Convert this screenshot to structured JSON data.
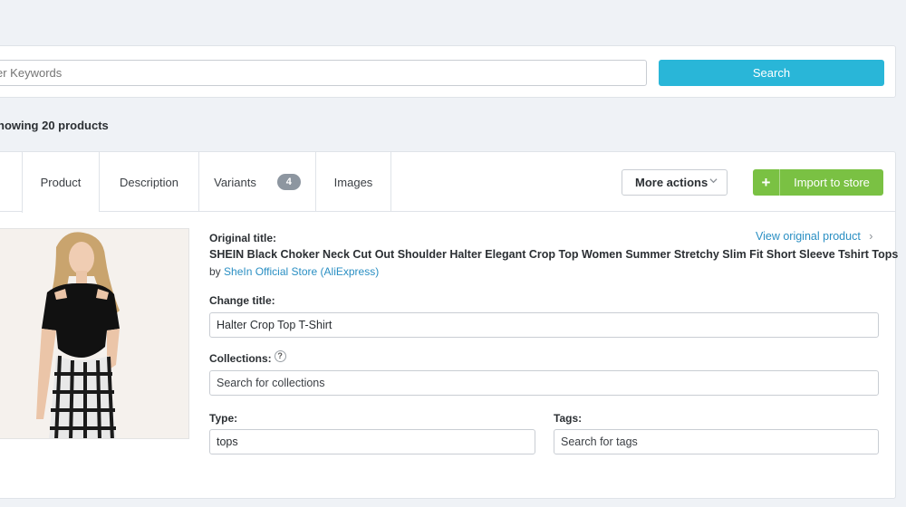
{
  "search": {
    "placeholder": "er Keywords",
    "button_label": "Search"
  },
  "results": {
    "showing_text": "howing 20 products"
  },
  "tabs": [
    {
      "label": "Product"
    },
    {
      "label": "Description"
    },
    {
      "label": "Variants",
      "badge": "4"
    },
    {
      "label": "Images"
    }
  ],
  "actions": {
    "more_actions_label": "More actions",
    "import_label": "Import to store",
    "import_icon": "+"
  },
  "product": {
    "original_title_label": "Original title:",
    "original_title": "SHEIN Black Choker Neck Cut Out Shoulder Halter Elegant Crop Top Women Summer Stretchy Slim Fit Short Sleeve Tshirt Tops",
    "by_prefix": "by",
    "store_link": "SheIn Official Store (AliExpress)",
    "view_original_label": "View original product",
    "change_title_label": "Change title:",
    "change_title_value": "Halter Crop Top T-Shirt",
    "collections_label": "Collections:",
    "collections_help": "?",
    "collections_placeholder": "Search for collections",
    "type_label": "Type:",
    "type_value": "tops",
    "tags_label": "Tags:",
    "tags_placeholder": "Search for tags"
  },
  "colors": {
    "search_button": "#29b6d8",
    "import_button": "#7ac143",
    "link": "#2a8fc3",
    "badge": "#8d96a0"
  }
}
